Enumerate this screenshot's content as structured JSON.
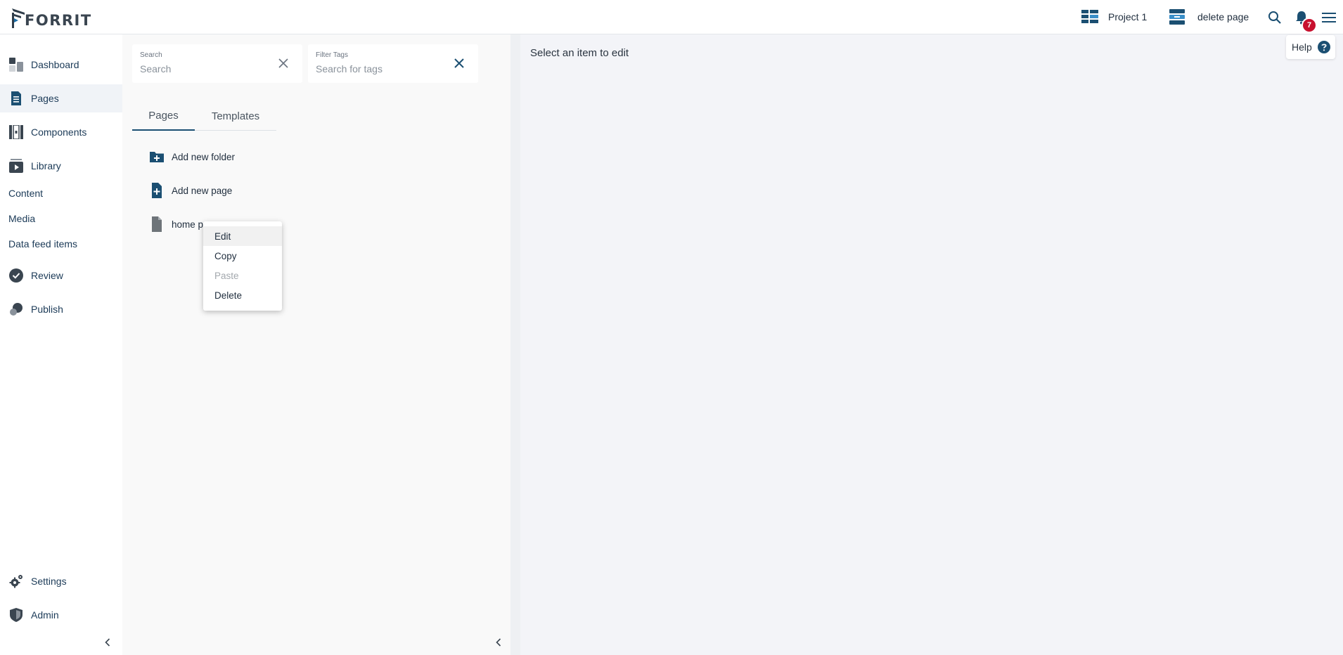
{
  "brand": {
    "name": "FORRIT",
    "accent": "#1b4f72",
    "badge_color": "#c8102e"
  },
  "topbar": {
    "project_label": "Project 1",
    "project_icon": "project-grid-icon",
    "page_label": "delete page",
    "page_icon": "page-stack-icon",
    "notification_count": "7"
  },
  "sidebar": {
    "items": [
      {
        "label": "Dashboard",
        "icon": "dashboard-icon"
      },
      {
        "label": "Pages",
        "icon": "pages-icon",
        "active": true
      },
      {
        "label": "Components",
        "icon": "components-icon"
      },
      {
        "label": "Library",
        "icon": "library-icon"
      },
      {
        "label": "Review",
        "icon": "review-shield-icon"
      },
      {
        "label": "Publish",
        "icon": "publish-icon"
      },
      {
        "label": "Settings",
        "icon": "gear-icon"
      },
      {
        "label": "Admin",
        "icon": "admin-shield-icon"
      }
    ],
    "library_sub": [
      "Content",
      "Media",
      "Data feed items"
    ]
  },
  "filters": {
    "search_label": "Search",
    "search_placeholder": "Search",
    "tags_label": "Filter Tags",
    "tags_placeholder": "Search for tags"
  },
  "tabs": [
    {
      "label": "Pages",
      "active": true
    },
    {
      "label": "Templates"
    }
  ],
  "tree": {
    "add_folder": "Add new folder",
    "add_page": "Add new page",
    "item_label": "home pa"
  },
  "context_menu": {
    "items": [
      {
        "label": "Edit",
        "state": "hover"
      },
      {
        "label": "Copy"
      },
      {
        "label": "Paste",
        "state": "disabled"
      },
      {
        "label": "Delete"
      }
    ]
  },
  "editor": {
    "empty_message": "Select an item to edit"
  },
  "help": {
    "label": "Help"
  }
}
